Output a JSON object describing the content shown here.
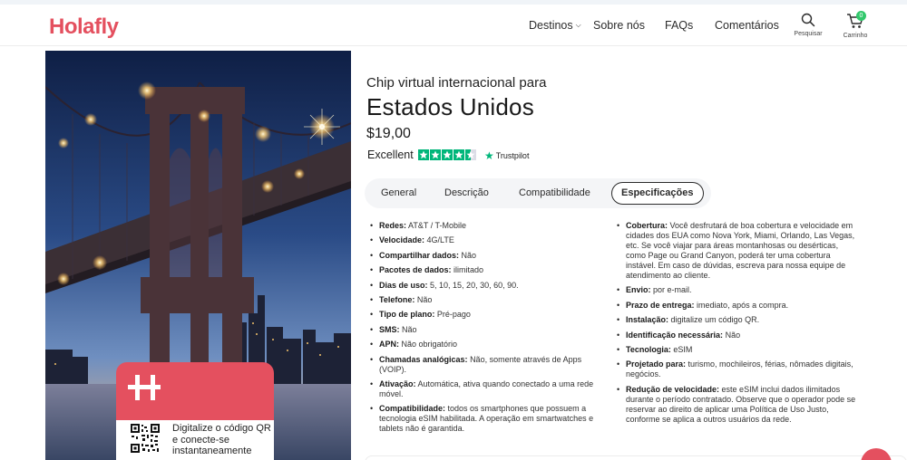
{
  "header": {
    "logo": "Holafly",
    "nav": {
      "destinos": "Destinos",
      "sobre": "Sobre nós",
      "faqs": "FAQs",
      "comentarios": "Comentários"
    },
    "search_label": "Pesquisar",
    "cart_label": "Carrinho",
    "cart_count": "0"
  },
  "card": {
    "text": "Digitalize o código QR e conecte-se instantaneamente"
  },
  "product": {
    "subtitle": "Chip virtual internacional para",
    "title": "Estados Unidos",
    "price": "$19,00",
    "rating_text": "Excellent",
    "rating_fraction": 0.9,
    "trust_brand": "Trustpilot"
  },
  "tabs": {
    "general": "General",
    "descricao": "Descrição",
    "compat": "Compatibilidade",
    "espec": "Especificações"
  },
  "specs_left": [
    {
      "label": "Redes:",
      "value": "AT&T / T-Mobile"
    },
    {
      "label": "Velocidade:",
      "value": "4G/LTE"
    },
    {
      "label": "Compartilhar dados:",
      "value": "Não"
    },
    {
      "label": "Pacotes de dados:",
      "value": "ilimitado"
    },
    {
      "label": "Dias de uso:",
      "value": "5, 10, 15, 20, 30, 60, 90."
    },
    {
      "label": "Telefone:",
      "value": "Não"
    },
    {
      "label": "Tipo de plano:",
      "value": "Pré-pago"
    },
    {
      "label": "SMS:",
      "value": "Não"
    },
    {
      "label": "APN:",
      "value": "Não obrigatório"
    },
    {
      "label": "Chamadas analógicas:",
      "value": "Não, somente através de Apps (VOIP)."
    },
    {
      "label": "Ativação:",
      "value": "Automática, ativa quando conectado a uma rede móvel."
    },
    {
      "label": "Compatibilidade:",
      "value": "todos os smartphones que possuem a tecnologia eSIM habilitada. A operação em smartwatches e tablets não é garantida."
    }
  ],
  "specs_right": [
    {
      "label": "Cobertura:",
      "value": "Você desfrutará de boa cobertura e velocidade em cidades dos EUA como Nova York, Miami, Orlando, Las Vegas, etc. Se você viajar para áreas montanhosas ou desérticas, como Page ou Grand Canyon, poderá ter uma cobertura instável. Em caso de dúvidas, escreva para nossa equipe de atendimento ao cliente."
    },
    {
      "label": "Envio:",
      "value": "por e-mail."
    },
    {
      "label": "Prazo de entrega:",
      "value": "imediato, após a compra."
    },
    {
      "label": "Instalação:",
      "value": "digitalize um código QR."
    },
    {
      "label": "Identificação necessária:",
      "value": "Não"
    },
    {
      "label": "Tecnologia:",
      "value": "eSIM"
    },
    {
      "label": "Projetado para:",
      "value": "turismo, mochileiros, férias, nômades digitais, negócios."
    },
    {
      "label": "Redução de velocidade:",
      "value": "este eSIM inclui dados ilimitados durante o período contratado. Observe que o operador pode se reservar ao direito de aplicar uma Política de Uso Justo, conforme se aplica a outros usuários da rede."
    }
  ],
  "colors": {
    "brand": "#e4505f",
    "trustpilot": "#00b67a",
    "cart_badge": "#32c86c"
  }
}
